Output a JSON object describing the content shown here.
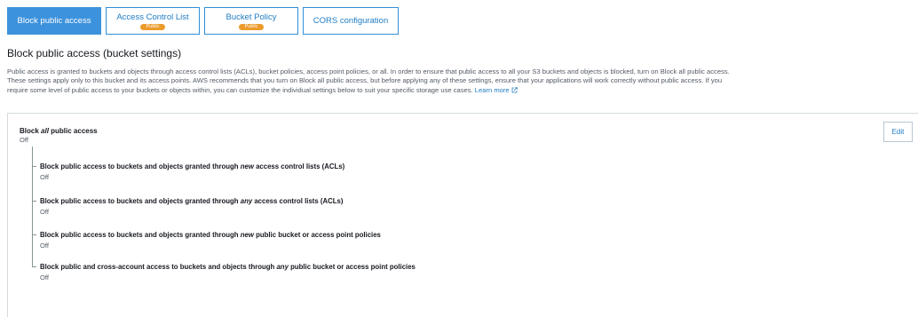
{
  "tabs": [
    {
      "label": "Block public access",
      "badge": ""
    },
    {
      "label": "Access Control List",
      "badge": "Public"
    },
    {
      "label": "Bucket Policy",
      "badge": "Public"
    },
    {
      "label": "CORS configuration",
      "badge": ""
    }
  ],
  "page": {
    "title": "Block public access (bucket settings)",
    "description_line1": "Public access is granted to buckets and objects through access control lists (ACLs), bucket policies, access point policies, or all. In order to ensure that public access to all your S3 buckets and objects is blocked, turn on Block all public access.",
    "description_line2": "These settings apply only to this bucket and its access points. AWS recommends that you turn on Block all public access, but before applying any of these settings, ensure that your applications will work correctly without public access. If you",
    "description_line3": "require some level of public access to your buckets or objects within, you can customize the individual settings below to suit your specific storage use cases.",
    "learn_more": "Learn more"
  },
  "master": {
    "label_pre": "Block ",
    "label_em": "all",
    "label_post": " public access",
    "value": "Off",
    "edit_label": "Edit"
  },
  "settings": [
    {
      "pre": "Block public access to buckets and objects granted through ",
      "em": "new",
      "post": " access control lists (ACLs)",
      "value": "Off"
    },
    {
      "pre": "Block public access to buckets and objects granted through ",
      "em": "any",
      "post": " access control lists (ACLs)",
      "value": "Off"
    },
    {
      "pre": "Block public access to buckets and objects granted through ",
      "em": "new",
      "post": " public bucket or access point policies",
      "value": "Off"
    },
    {
      "pre": "Block public and cross-account access to buckets and objects through ",
      "em": "any",
      "post": " public bucket or access point policies",
      "value": "Off"
    }
  ],
  "colors": {
    "accent": "#3c92dc",
    "link": "#1f7cc4",
    "badge": "#ec9b2b"
  },
  "icons": {
    "external_link": "external-link-icon"
  }
}
